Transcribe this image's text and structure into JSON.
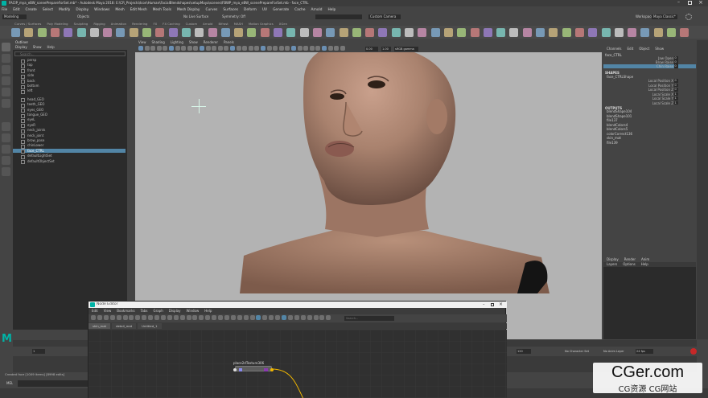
{
  "window": {
    "title": "FACIP_mya_eBW_scenePrepareForSet.mb* - Autodesk Maya 2018: E:\\CR_Projects\\Icon\\Human\\FacialBlendshapes\\setupMaya\\scenes\\FBWP_mya_eBW_scenePrepareForSet.mb - face_CTRL",
    "brand_color": "#00b3a6"
  },
  "main_menu": [
    "File",
    "Edit",
    "Create",
    "Select",
    "Modify",
    "Display",
    "Windows",
    "Mesh",
    "Edit Mesh",
    "Mesh Tools",
    "Mesh Display",
    "Curves",
    "Surfaces",
    "Deform",
    "UV",
    "Generate",
    "Cache",
    "Arnold",
    "Help"
  ],
  "status_line": {
    "menuset": "Modeling",
    "objects_label": "Objects",
    "live_surface": "No Live Surface",
    "symmetry": "Symmetry: Off",
    "camera": "Custom Camera",
    "workspace_label": "Workspace:",
    "workspace_value": "Maya Classic*"
  },
  "shelf_tabs": [
    "Curves / Surfaces",
    "Poly Modeling",
    "Sculpting",
    "Rigging",
    "Animation",
    "Rendering",
    "FX",
    "FX Caching",
    "Custom",
    "Arnold",
    "Bifrost",
    "MASH",
    "Motion Graphics",
    "XGen"
  ],
  "outliner": {
    "title": "Outliner",
    "menu": [
      "Display",
      "Show",
      "Help"
    ],
    "search_placeholder": "Search...",
    "items": [
      "persp",
      "top",
      "front",
      "side",
      "back",
      "bottom",
      "left",
      "head_GEO",
      "teeth_GEO",
      "eyes_GEO",
      "tongue_GEO",
      "eyeL",
      "eyeR",
      "neck_joints",
      "neck_joint",
      "brow_pose",
      "chinLower",
      "face_CTRL",
      "defaultLightSet",
      "defaultObjectSet"
    ],
    "selected_index": 17
  },
  "viewport": {
    "menu": [
      "View",
      "Shading",
      "Lighting",
      "Show",
      "Renderer",
      "Panels"
    ],
    "camera_label": "persp1 (NONE)",
    "camera_field": "0.00",
    "gamma": "1.00",
    "colorspace": "sRGB gamma"
  },
  "attribute_editor": {
    "tabs": [
      "Channels",
      "Edit",
      "Object",
      "Show"
    ],
    "node_name": "face_CTRL",
    "channels": [
      {
        "label": "Jaw Open",
        "value": "0"
      },
      {
        "label": "Brow Raise",
        "value": "0"
      },
      {
        "label": "Chin Raise",
        "value": "0"
      }
    ],
    "shapes_header": "SHAPES",
    "shape_name": "face_CTRLShape",
    "local_attrs": [
      {
        "label": "Local Position X",
        "value": "0"
      },
      {
        "label": "Local Position Y",
        "value": "0"
      },
      {
        "label": "Local Position Z",
        "value": "0"
      },
      {
        "label": "Local Scale X",
        "value": "1"
      },
      {
        "label": "Local Scale Y",
        "value": "1"
      },
      {
        "label": "Local Scale Z",
        "value": "1"
      }
    ],
    "outputs_header": "OUTPUTS",
    "outputs": [
      "blendShape104",
      "blendShape101",
      "file137",
      "blendColors4",
      "blendColors5",
      "colorCorrect136",
      "skin_mat",
      "file139"
    ]
  },
  "layer_editor": {
    "tabs": [
      "Display",
      "Render",
      "Anim"
    ],
    "menu": [
      "Layers",
      "Options",
      "Help"
    ]
  },
  "node_editor": {
    "title": "Node Editor",
    "menu": [
      "Edit",
      "View",
      "Bookmarks",
      "Tabs",
      "Graph",
      "Display",
      "Window",
      "Help"
    ],
    "tabs": [
      "skin_mat",
      "detail_mat",
      "Untitled_1"
    ],
    "search_placeholder": "Search...",
    "node_label": "place2dTexture306"
  },
  "timeline": {
    "start": "1",
    "end": "120",
    "current": "1",
    "character_set": "No Character Set",
    "anim_layer": "No Anim Layer",
    "fps": "24 fps"
  },
  "command_line": {
    "mode": "MEL",
    "status": "Created face [1009 items] [8998 edits]"
  },
  "watermark": {
    "main": "CGer.com",
    "sub": "CG资源 CG网站"
  }
}
